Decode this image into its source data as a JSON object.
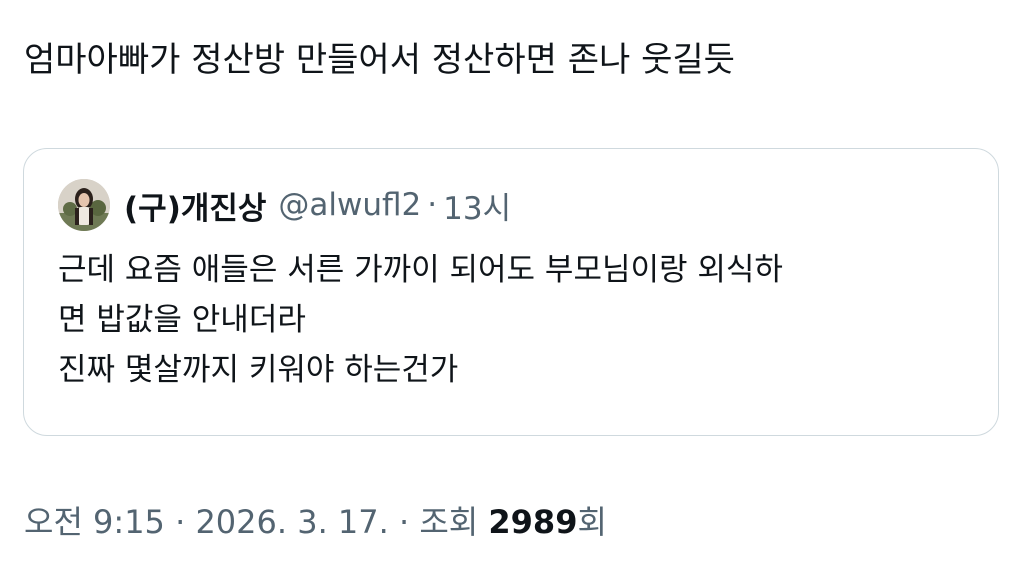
{
  "tweet": {
    "text": "엄마아빠가 정산방 만들어서 정산하면 존나 웃길듯"
  },
  "quote": {
    "author_name": "(구)개진상",
    "author_handle": "@alwufl2",
    "separator": "·",
    "time": "13시",
    "avatar_icon": "profile-photo",
    "lines": [
      "근데 요즘 애들은 서른 가까이 되어도 부모님이랑 외식하",
      "면 밥값을 안내더라",
      "진짜 몇살까지 키워야 하는건가"
    ]
  },
  "meta": {
    "time": "오전 9:15",
    "separator": "·",
    "date": "2026. 3. 17.",
    "views_label_prefix": "조회",
    "views_count": "2989",
    "views_suffix": "회"
  }
}
